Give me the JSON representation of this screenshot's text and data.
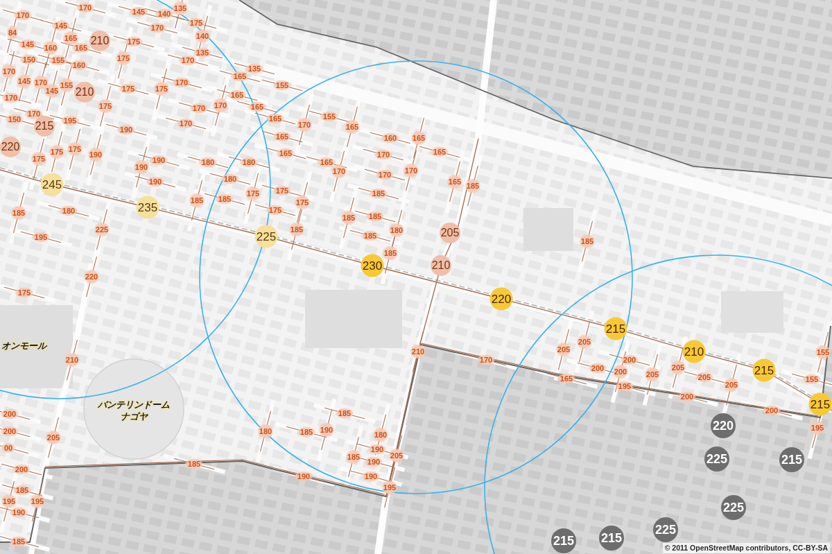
{
  "map": {
    "segment_labels": [
      "170",
      "145",
      "140",
      "135",
      "170",
      "145",
      "170",
      "175",
      "84",
      "165",
      "175",
      "140",
      "145",
      "160",
      "165",
      "135",
      "150",
      "155",
      "160",
      "175",
      "170",
      "170",
      "165",
      "135",
      "145",
      "170",
      "145",
      "155",
      "175",
      "175",
      "170",
      "165",
      "155",
      "170",
      "175",
      "170",
      "170",
      "165",
      "150",
      "170",
      "195",
      "170",
      "165",
      "170",
      "155",
      "190",
      "165",
      "165",
      "160",
      "165",
      "175",
      "175",
      "175",
      "190",
      "190",
      "180",
      "180",
      "165",
      "165",
      "170",
      "165",
      "190",
      "190",
      "180",
      "170",
      "170",
      "170",
      "165",
      "185",
      "185",
      "180",
      "185",
      "185",
      "175",
      "175",
      "175",
      "175",
      "185",
      "185",
      "185",
      "195",
      "225",
      "185",
      "185",
      "180",
      "185",
      "185",
      "220",
      "175",
      "210",
      "210",
      "170",
      "205",
      "205",
      "200",
      "155",
      "165",
      "200",
      "200",
      "195",
      "205",
      "205",
      "205",
      "205",
      "155",
      "200",
      "200",
      "185",
      "200",
      "200",
      "205",
      "180",
      "185",
      "190",
      "180",
      "195",
      "00",
      "185",
      "185",
      "190",
      "190",
      "205",
      "200",
      "190",
      "190",
      "185",
      "195",
      "195",
      "195",
      "190",
      "185"
    ],
    "junction_labels": [
      "210",
      "210",
      "215",
      "220",
      "205",
      "210"
    ],
    "station_markers": [
      {
        "value": "245",
        "dimmed": true
      },
      {
        "value": "235",
        "dimmed": true
      },
      {
        "value": "225",
        "dimmed": true
      },
      {
        "value": "230",
        "dimmed": false
      },
      {
        "value": "220",
        "dimmed": false
      },
      {
        "value": "215",
        "dimmed": false
      },
      {
        "value": "210",
        "dimmed": false
      },
      {
        "value": "215",
        "dimmed": false
      },
      {
        "value": "215",
        "dimmed": false
      }
    ],
    "area_markers": [
      "220",
      "225",
      "215",
      "225",
      "215",
      "215",
      "225"
    ],
    "landmark_labels": [
      {
        "lines": [
          "オンモール"
        ]
      },
      {
        "lines": [
          "バンテリンドーム",
          "ナゴヤ"
        ]
      }
    ]
  },
  "attribution": "© 2011 OpenStreetMap contributors, CC-BY-SA"
}
